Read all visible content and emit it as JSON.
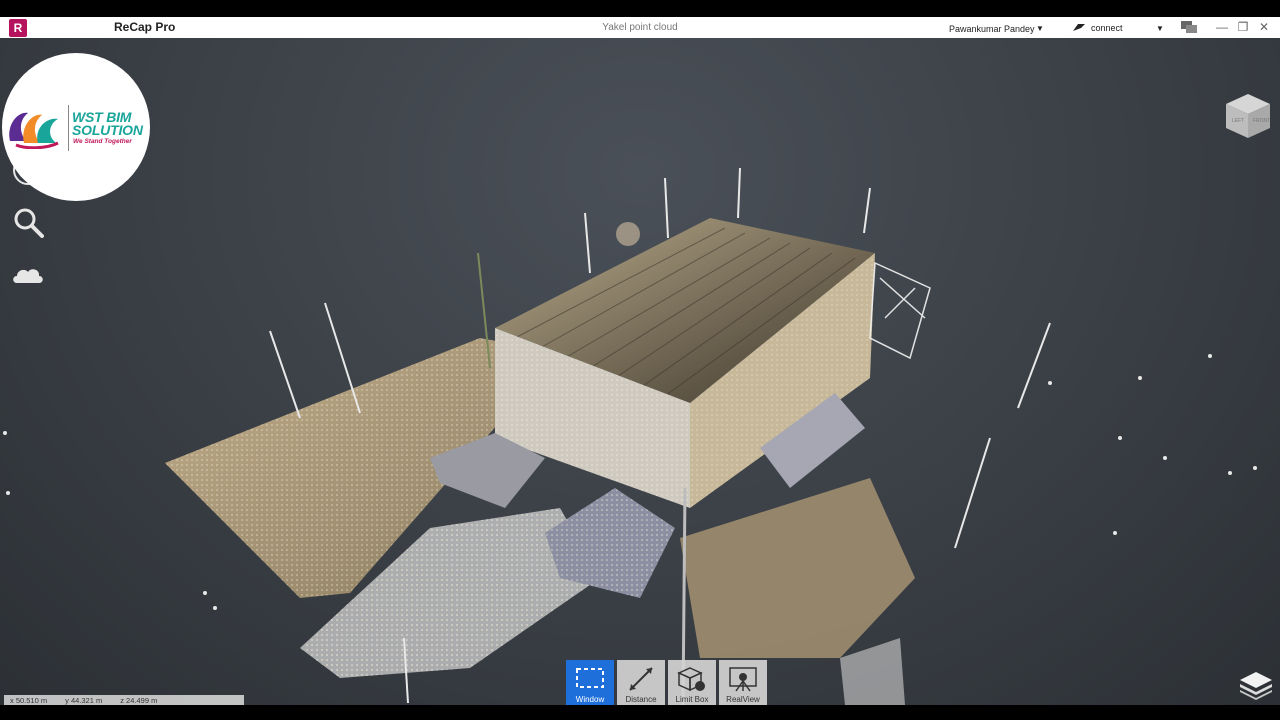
{
  "titlebar": {
    "app_icon_letter": "R",
    "app_title": "ReCap Pro",
    "document_title": "Yakel point cloud",
    "user_name": "Pawankumar Pandey",
    "connect_label": "connect",
    "icons": [
      "connect-icon",
      "chat-icon",
      "minimize-icon",
      "restore-icon",
      "close-icon"
    ]
  },
  "logo": {
    "line1": "WST BIM",
    "line2": "SOLUTION",
    "tagline": "We Stand Together",
    "colors": {
      "teal": "#1aa59a",
      "magenta": "#c2185b",
      "purple": "#5b2c91",
      "orange": "#f28c28"
    }
  },
  "left_tools": [
    {
      "name": "navigation-wheel-icon"
    },
    {
      "name": "search-icon"
    },
    {
      "name": "cloud-icon"
    }
  ],
  "viewcube": {
    "faces": [
      "LEFT",
      "FRONT"
    ]
  },
  "bottom_toolbar": [
    {
      "label": "Window",
      "icon": "window-select-icon",
      "active": true
    },
    {
      "label": "Distance",
      "icon": "distance-measure-icon",
      "active": false
    },
    {
      "label": "Limit Box",
      "icon": "limit-box-icon",
      "active": false
    },
    {
      "label": "RealView",
      "icon": "realview-icon",
      "active": false
    }
  ],
  "coordinates": {
    "x": "x 50.510 m",
    "y": "y 44.321 m",
    "z": "z 24.499 m"
  },
  "colors": {
    "viewport_bg": "#3a3f45",
    "active_tool": "#1e6fd9",
    "brand": "#b5135d"
  }
}
